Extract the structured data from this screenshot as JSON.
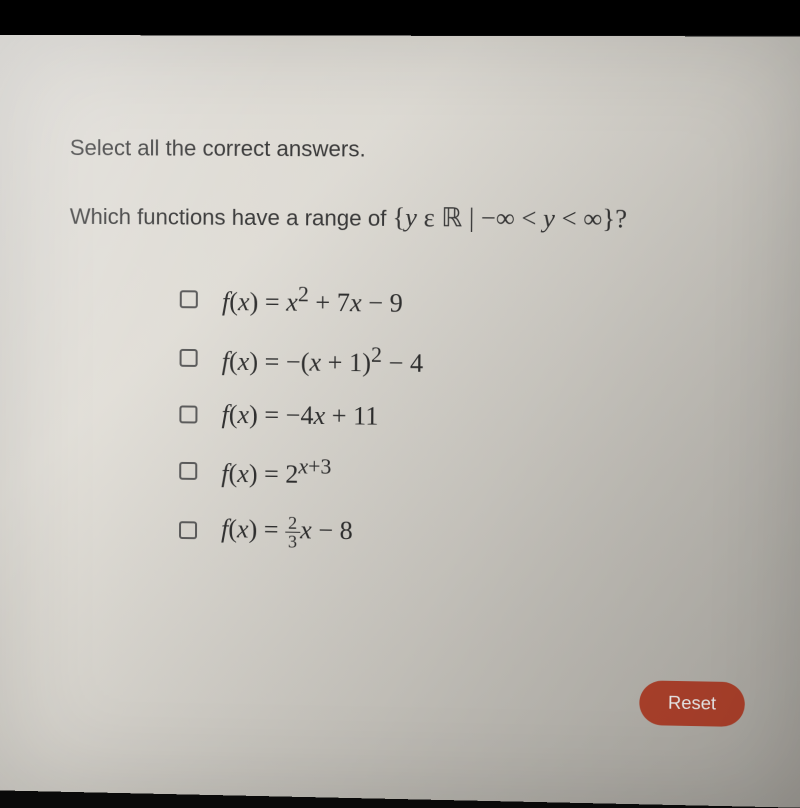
{
  "question": {
    "instruction": "Select all the correct answers.",
    "prompt_prefix": "Which functions have a range of",
    "set_notation": "{y ε ℝ | −∞ < y < ∞}",
    "prompt_suffix": "?"
  },
  "options": [
    {
      "label": "f(x) = x² + 7x − 9",
      "checked": false
    },
    {
      "label": "f(x) = −(x + 1)² − 4",
      "checked": false
    },
    {
      "label": "f(x) = −4x + 11",
      "checked": false
    },
    {
      "label": "f(x) = 2^(x+3)",
      "checked": false
    },
    {
      "label": "f(x) = (2/3)x − 8",
      "checked": false
    }
  ],
  "buttons": {
    "reset": "Reset"
  }
}
